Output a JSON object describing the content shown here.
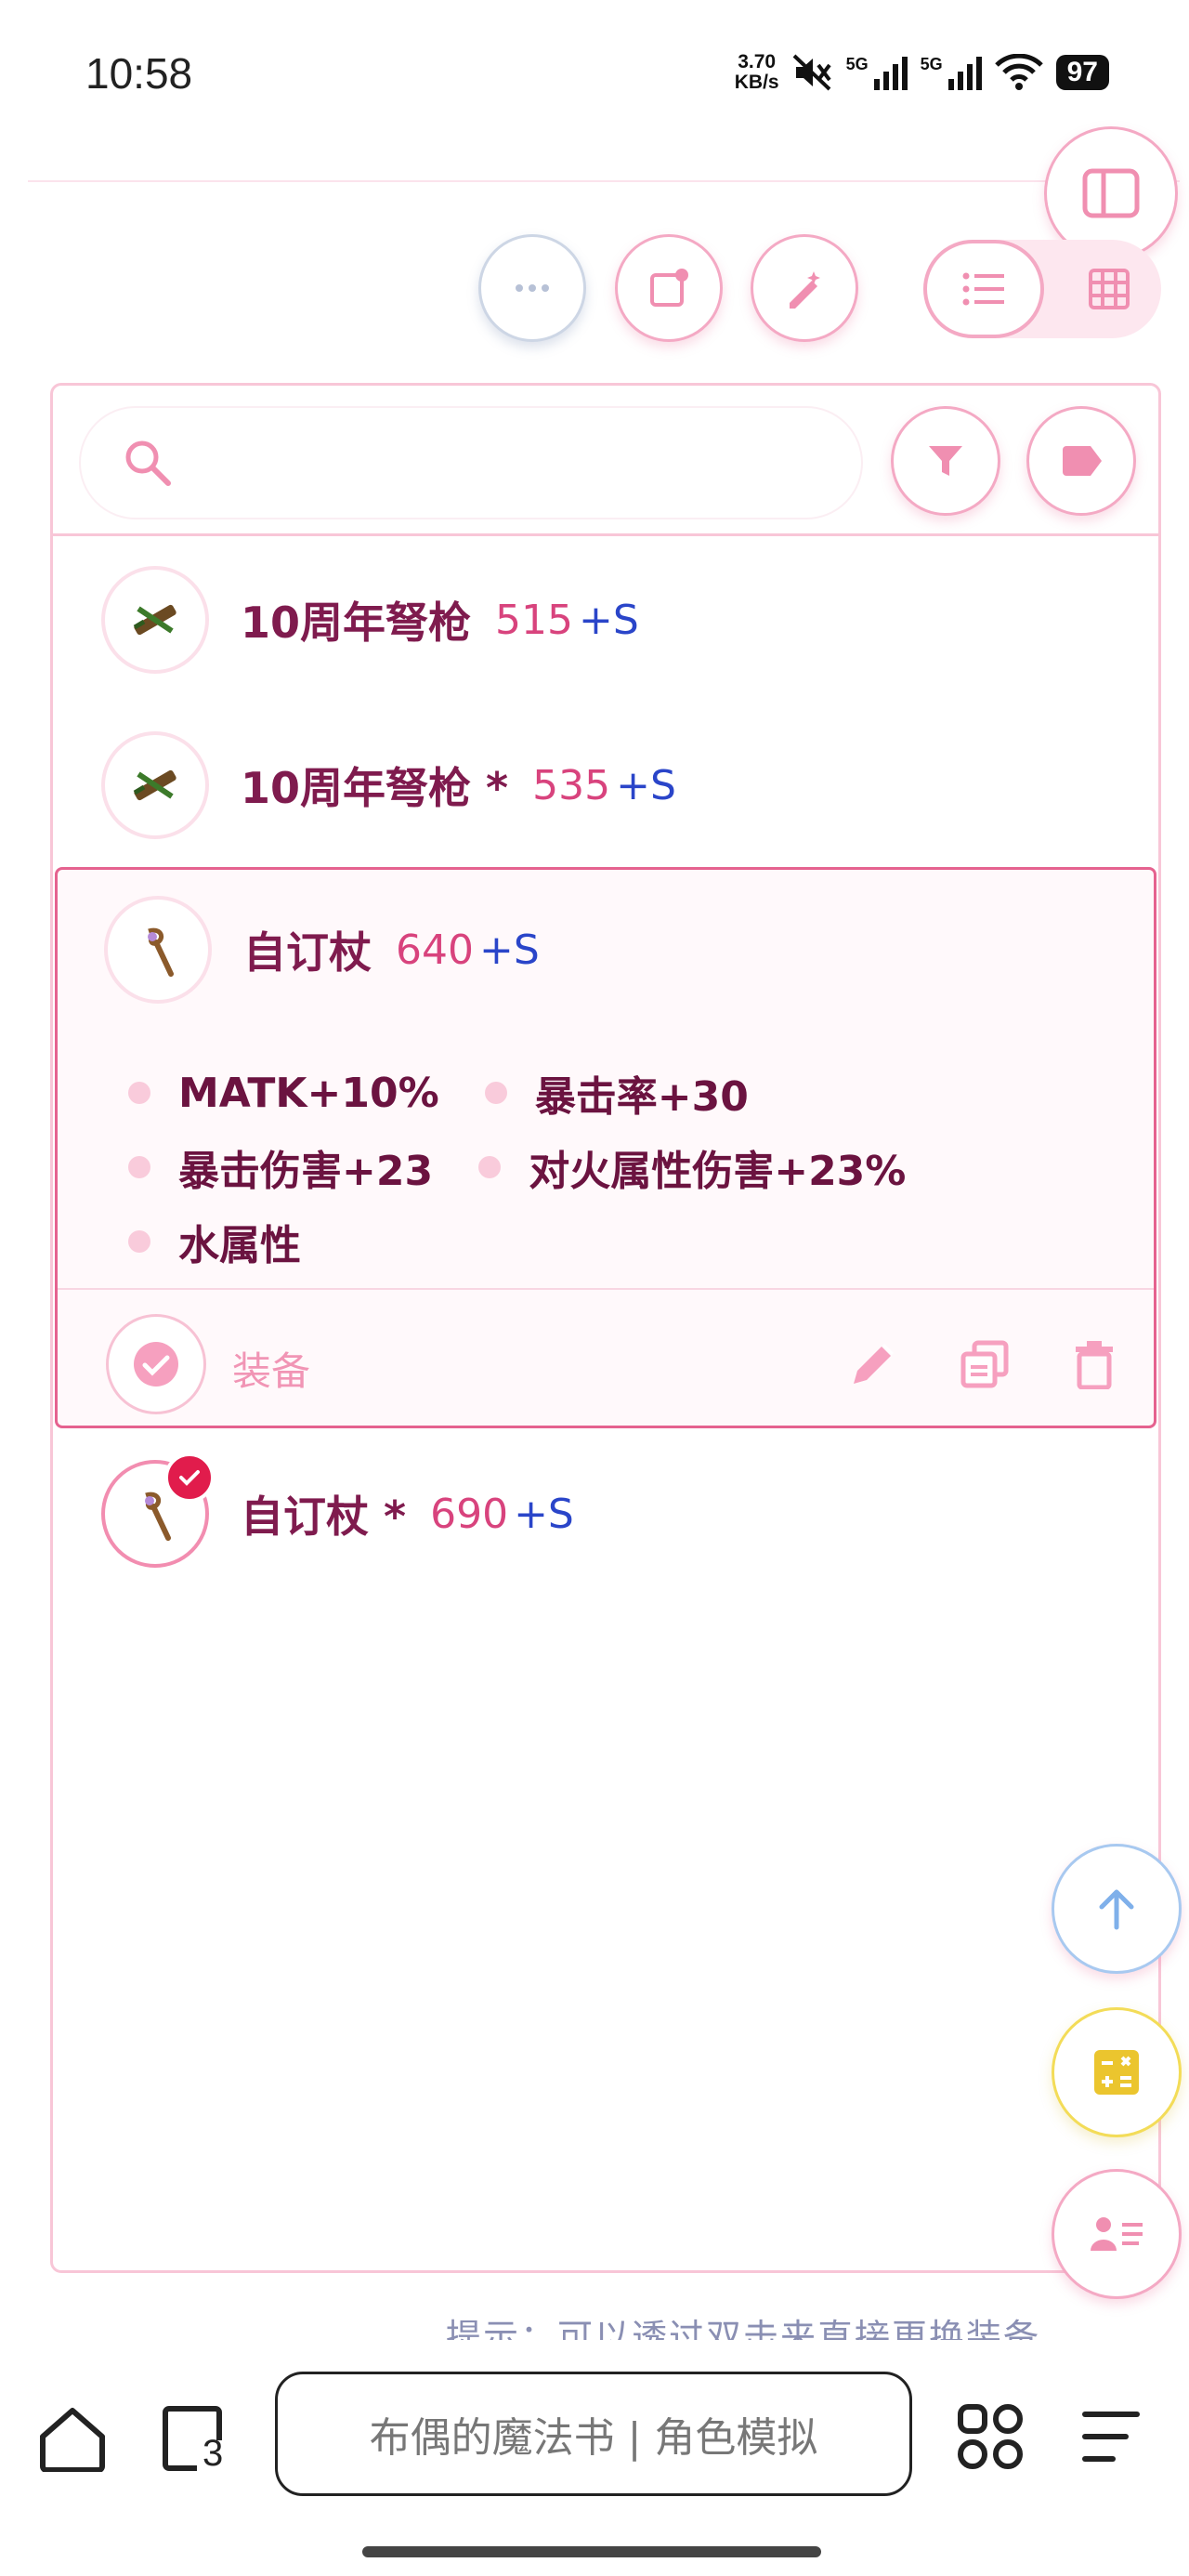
{
  "status": {
    "time": "10:58",
    "net_speed_value": "3.70",
    "net_speed_unit": "KB/s",
    "sim1": "5G",
    "sim2": "5G",
    "battery": "97"
  },
  "panel": {
    "items": [
      {
        "name": "10周年弩枪",
        "value": "515",
        "bonus": "+S",
        "icon": "crossbow-icon"
      },
      {
        "name": "10周年弩枪 *",
        "value": "535",
        "bonus": "+S",
        "icon": "crossbow-icon"
      },
      {
        "name": "自订杖",
        "value": "640",
        "bonus": "+S",
        "icon": "staff-icon",
        "stats": [
          "MATK+10%",
          "暴击率+30",
          "暴击伤害+23",
          "对火属性伤害+23%",
          "水属性"
        ]
      },
      {
        "name": "自订杖 *",
        "value": "690",
        "bonus": "+S",
        "icon": "staff-icon",
        "equipped": true
      }
    ],
    "equip_label": "装备"
  },
  "hint": "提示：可以透过双击来直接更换装备",
  "browser": {
    "url_title": "布偶的魔法书 | 角色模拟",
    "tab_count": "3"
  },
  "colors": {
    "accent_pink": "#f4a9c4",
    "name_color": "#7f1b4e",
    "value_color": "#d8437d",
    "bonus_color": "#2a45c9",
    "selected_border": "#e5628f",
    "equipped_badge": "#e11c4c"
  }
}
